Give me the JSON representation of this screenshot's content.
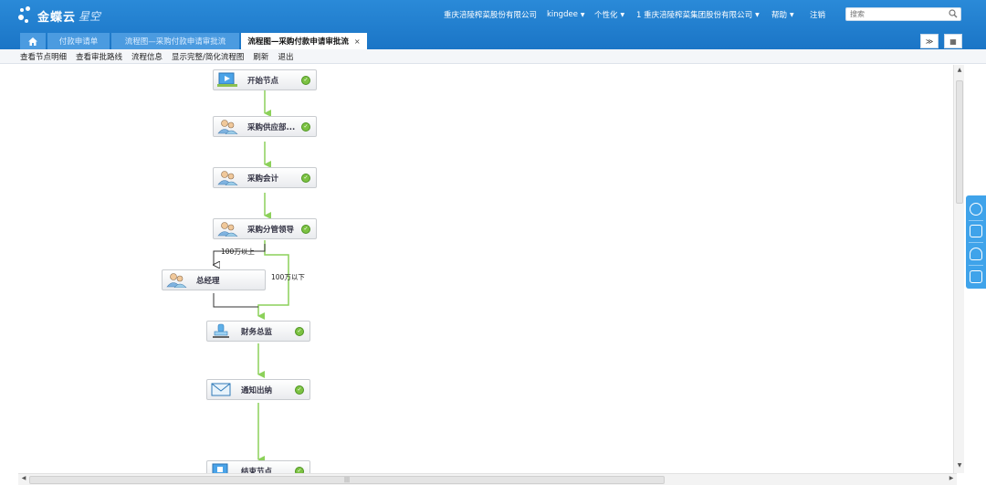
{
  "header": {
    "brand": "金蝶云",
    "brand_sub": "星空",
    "company": "重庆涪陵榨菜股份有限公司",
    "user": "kingdee",
    "personalize": "个性化",
    "org": "1 重庆涪陵榨菜集团股份有限公司",
    "help": "帮助",
    "logout": "注销",
    "search_placeholder": "搜索"
  },
  "tabs": [
    {
      "label": "付款申请单"
    },
    {
      "label": "流程图—采购付款申请审批流"
    },
    {
      "label": "流程图—采购付款申请审批流",
      "close": "×"
    }
  ],
  "right_buttons": {
    "collapse": "≫",
    "grid": "▦"
  },
  "toolbar": [
    "查看节点明细",
    "查看审批路线",
    "流程信息",
    "显示完整/简化流程图",
    "刷新",
    "退出"
  ],
  "flow": {
    "nodes": [
      {
        "label": "开始节点",
        "icon": "start-icon",
        "done": true
      },
      {
        "label": "采购供应部...",
        "icon": "users-icon",
        "done": true
      },
      {
        "label": "采购会计",
        "icon": "users-icon",
        "done": true
      },
      {
        "label": "采购分管领导",
        "icon": "users-icon",
        "done": true
      },
      {
        "label": "总经理",
        "icon": "users-icon",
        "done": false
      },
      {
        "label": "财务总监",
        "icon": "stamp-icon",
        "done": true
      },
      {
        "label": "通知出纳",
        "icon": "mail-icon",
        "done": true
      },
      {
        "label": "结束节点",
        "icon": "end-icon",
        "done": true
      }
    ],
    "edge_labels": {
      "above": "100万以上",
      "below": "100万以下"
    }
  },
  "colors": {
    "header": "#1f7fcf",
    "tab_active": "#ffffff",
    "edge_green": "#8cd15a",
    "edge_dark": "#333333",
    "ok_green": "#7cc242"
  }
}
